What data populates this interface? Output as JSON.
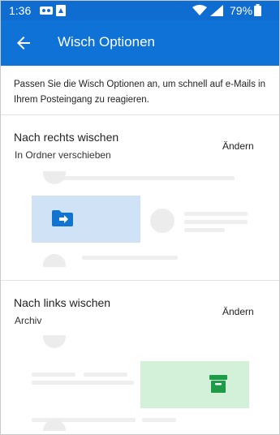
{
  "status_bar": {
    "time": "1:36",
    "battery": "79%",
    "icons": [
      "voicemail-icon",
      "notification-icon",
      "wifi-icon",
      "signal-icon",
      "battery-icon"
    ]
  },
  "app_bar": {
    "title": "Wisch Optionen",
    "back_icon": "arrow-left-icon"
  },
  "intro_text": "Passen Sie die Wisch Optionen an, um schnell auf e-Mails in Ihrem Posteingang zu reagieren.",
  "right_swipe": {
    "title": "Nach rechts wischen",
    "action": "In Ordner verschieben",
    "change_label": "Ändern",
    "icon": "move-to-folder-icon",
    "color": "#cfe2f6",
    "icon_color": "#1274d1"
  },
  "left_swipe": {
    "title": "Nach links wischen",
    "action": "Archiv",
    "change_label": "Ändern",
    "icon": "archive-icon",
    "color": "#d2f1d8",
    "icon_color": "#1e9b47"
  },
  "colors": {
    "header": "#0f72d6",
    "status_bar": "#0f6cd0"
  }
}
